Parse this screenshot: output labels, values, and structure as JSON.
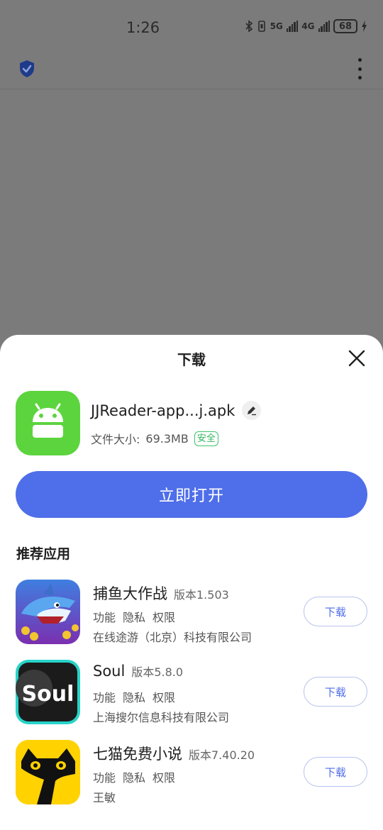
{
  "status_bar": {
    "time": "1:26",
    "network_5g": "5G",
    "network_4g": "4G",
    "battery": "68"
  },
  "sheet": {
    "title": "下载",
    "file": {
      "name": "JJReader-app...j.apk",
      "size_label": "文件大小:",
      "size_value": "69.3MB",
      "safe_badge": "安全",
      "icon": "android-icon",
      "icon_color": "#5cd43e"
    },
    "open_button": "立即打开",
    "recommend_heading": "推荐应用",
    "apps": [
      {
        "name": "捕鱼大作战",
        "version": "版本1.503",
        "links": [
          "功能",
          "隐私",
          "权限"
        ],
        "developer": "在线途游（北京）科技有限公司",
        "download_label": "下载",
        "icon": "shark-game-icon"
      },
      {
        "name": "Soul",
        "version": "版本5.8.0",
        "links": [
          "功能",
          "隐私",
          "权限"
        ],
        "developer": "上海搜尔信息科技有限公司",
        "download_label": "下载",
        "icon": "soul-logo-icon",
        "icon_text": "Soul"
      },
      {
        "name": "七猫免费小说",
        "version": "版本7.40.20",
        "links": [
          "功能",
          "隐私",
          "权限"
        ],
        "developer": "王敏",
        "download_label": "下载",
        "icon": "seven-cat-icon"
      }
    ]
  },
  "colors": {
    "accent": "#4f6ee9",
    "safe": "#2fb65c",
    "overlay": "#7b7b7b"
  }
}
